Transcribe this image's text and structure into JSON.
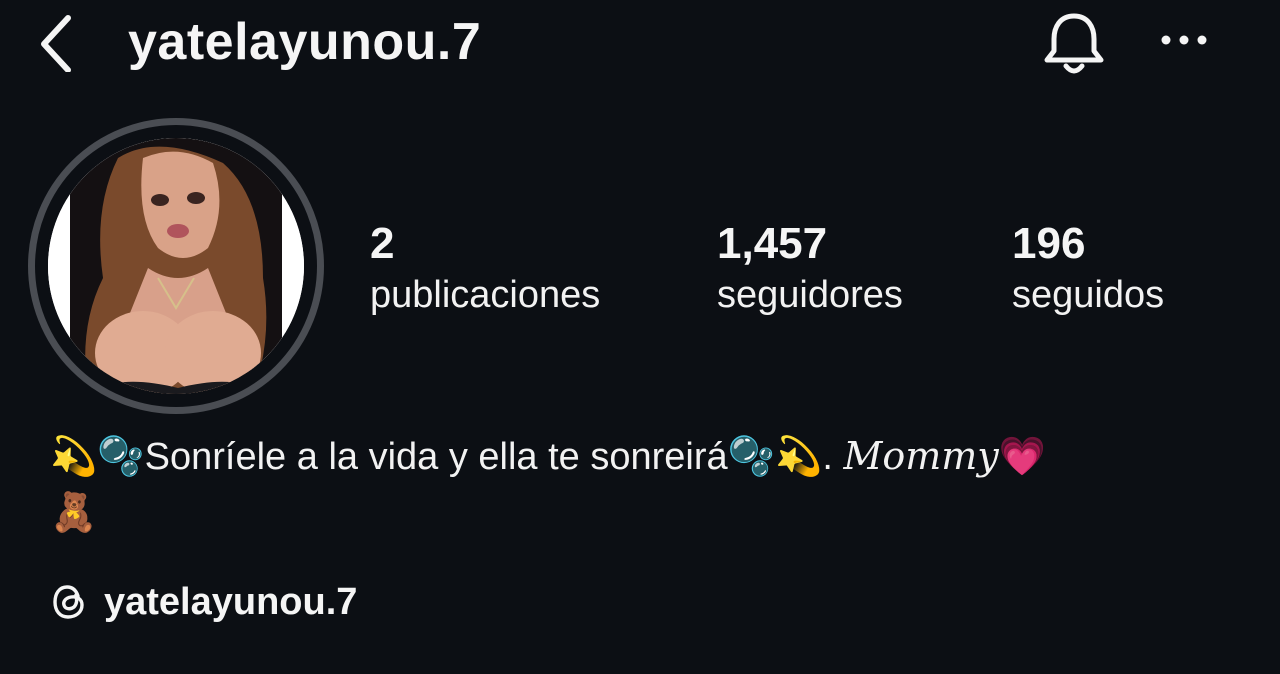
{
  "header": {
    "username": "yatelayunou.7",
    "back_icon": "chevron-left-icon",
    "bell_icon": "bell-icon",
    "more_icon": "more-horizontal-icon"
  },
  "profile": {
    "avatar": "profile-photo",
    "stats": [
      {
        "value": "2",
        "label": "publicaciones"
      },
      {
        "value": "1,457",
        "label": "seguidores"
      },
      {
        "value": "196",
        "label": "seguidos"
      }
    ],
    "bio": {
      "emoji_1": "💫",
      "emoji_2": "🫧",
      "text": "Sonríele a la vida y ella te sonreirá",
      "emoji_3": "🫧",
      "emoji_4": "💫",
      "dot": ". ",
      "mommy": "Mommy",
      "emoji_5": "💗",
      "emoji_6": "🧸"
    },
    "threads": {
      "icon": "threads-icon",
      "handle": "yatelayunou.7"
    }
  },
  "colors": {
    "background": "#0c0f14",
    "text": "#f5f5f5",
    "avatar_ring": "#4a4d53"
  }
}
